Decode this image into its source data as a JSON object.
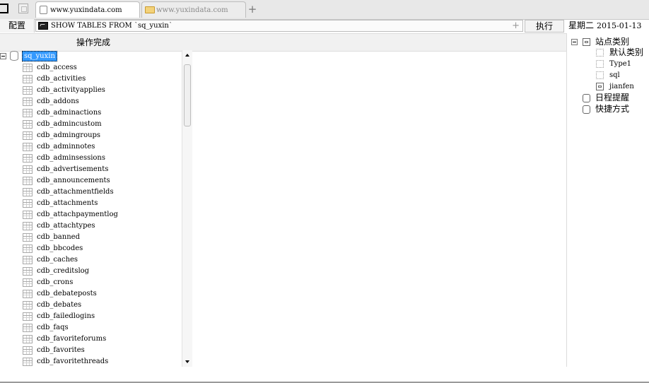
{
  "tabs": [
    {
      "label": "www.yuxindata.com",
      "active": true,
      "icon": "page-icon"
    },
    {
      "label": "www.yuxindata.com",
      "active": false,
      "icon": "folder-icon"
    }
  ],
  "toolbar": {
    "config_label": "配置",
    "command_value": "SHOW TABLES FROM `sq_yuxin`",
    "run_label": "执行",
    "weekday": "星期二",
    "date": "2015-01-13"
  },
  "status": "操作完成",
  "db_tree": {
    "database": "sq_yuxin",
    "tables": [
      "cdb_access",
      "cdb_activities",
      "cdb_activityapplies",
      "cdb_addons",
      "cdb_adminactions",
      "cdb_admincustom",
      "cdb_admingroups",
      "cdb_adminnotes",
      "cdb_adminsessions",
      "cdb_advertisements",
      "cdb_announcements",
      "cdb_attachmentfields",
      "cdb_attachments",
      "cdb_attachpaymentlog",
      "cdb_attachtypes",
      "cdb_banned",
      "cdb_bbcodes",
      "cdb_caches",
      "cdb_creditslog",
      "cdb_crons",
      "cdb_debateposts",
      "cdb_debates",
      "cdb_failedlogins",
      "cdb_faqs",
      "cdb_favoriteforums",
      "cdb_favorites",
      "cdb_favoritethreads"
    ]
  },
  "right_panel": {
    "site_category": "站点类别",
    "categories": [
      "默认类别",
      "Type1",
      "sql",
      "jianfen"
    ],
    "reminders": "日程提醒",
    "shortcuts": "快捷方式"
  },
  "colors": {
    "selection": "#3399ff",
    "panel_bg": "#f1f1f1"
  }
}
